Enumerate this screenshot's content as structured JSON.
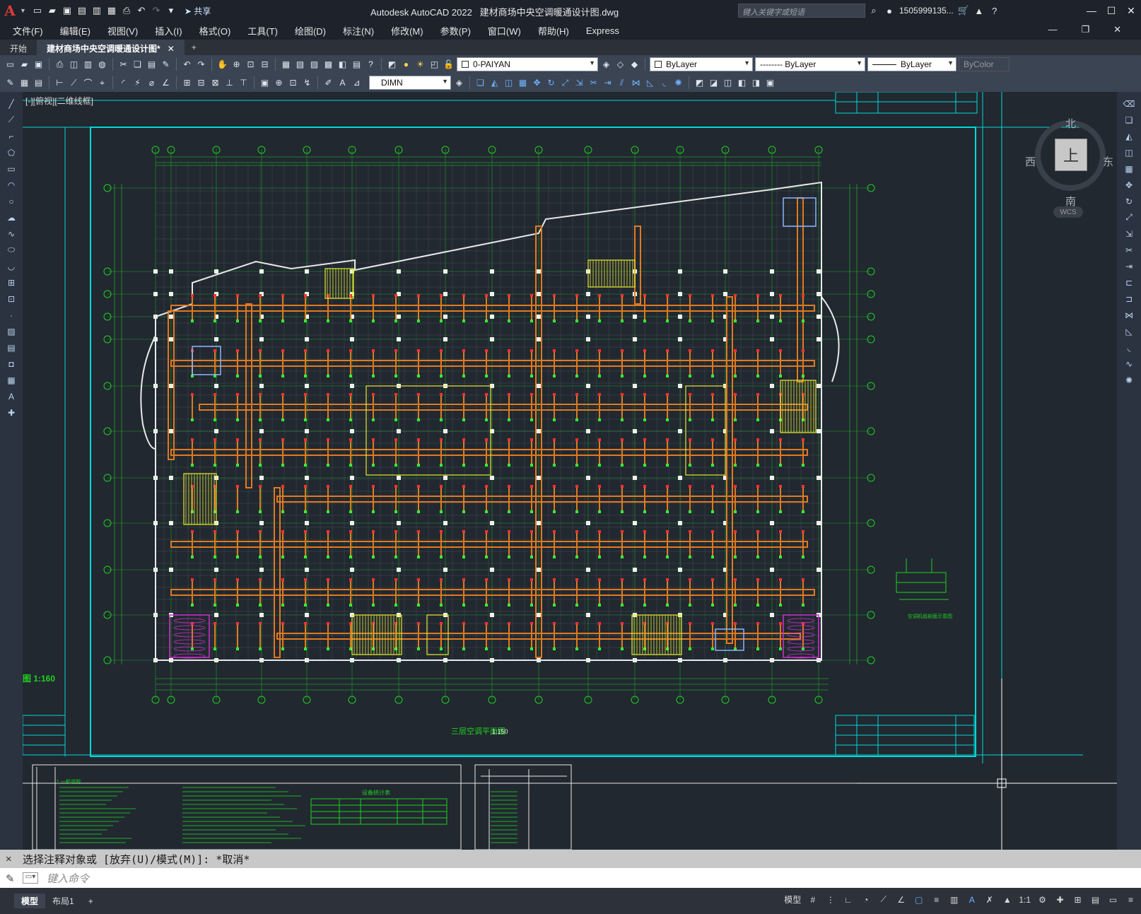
{
  "app": {
    "logo": "A",
    "title": "Autodesk AutoCAD 2022",
    "file": "建材商场中央空调暖通设计图.dwg"
  },
  "quick_access": {
    "share_label": "共享"
  },
  "search": {
    "placeholder": "键入关键字或短语"
  },
  "user": {
    "name": "1505999135..."
  },
  "menus": [
    "文件(F)",
    "编辑(E)",
    "视图(V)",
    "插入(I)",
    "格式(O)",
    "工具(T)",
    "绘图(D)",
    "标注(N)",
    "修改(M)",
    "参数(P)",
    "窗口(W)",
    "帮助(H)",
    "Express"
  ],
  "tabs": [
    {
      "label": "开始"
    },
    {
      "label": "建材商场中央空调暖通设计图*",
      "active": true
    }
  ],
  "toolbar": {
    "layer": "0-PAIYAN",
    "color": "ByLayer",
    "linetype": "-------- ByLayer",
    "lineweight": "ByLayer",
    "plotstyle": "ByColor",
    "dimstyle": "DIMN"
  },
  "viewport": {
    "label": "[-][俯视][二维线框]"
  },
  "viewcube": {
    "north": "北",
    "south": "南",
    "east": "东",
    "west": "西",
    "top": "上",
    "wcs": "WCS"
  },
  "drawing": {
    "plan_title": "三层空调平面图",
    "plan_scale": "1:150",
    "left_scale": "图 1:160",
    "detail_title": "空调机组剖面示意图",
    "table_title": "设备统计表",
    "notes_title": "1.一般说明"
  },
  "command": {
    "history": "选择注释对象或 [放弃(U)/模式(M)]: *取消*",
    "placeholder": "键入命令"
  },
  "status": {
    "tabs": [
      "模型",
      "布局1"
    ],
    "model": "模型",
    "scale": "1:1"
  },
  "colors": {
    "grid": "#20d020",
    "duct": "#e07a20",
    "frame": "#00d8d8",
    "wall": "#f0f0f0",
    "yellow": "#e8e830",
    "magenta": "#d030d0",
    "bg": "#212830"
  }
}
